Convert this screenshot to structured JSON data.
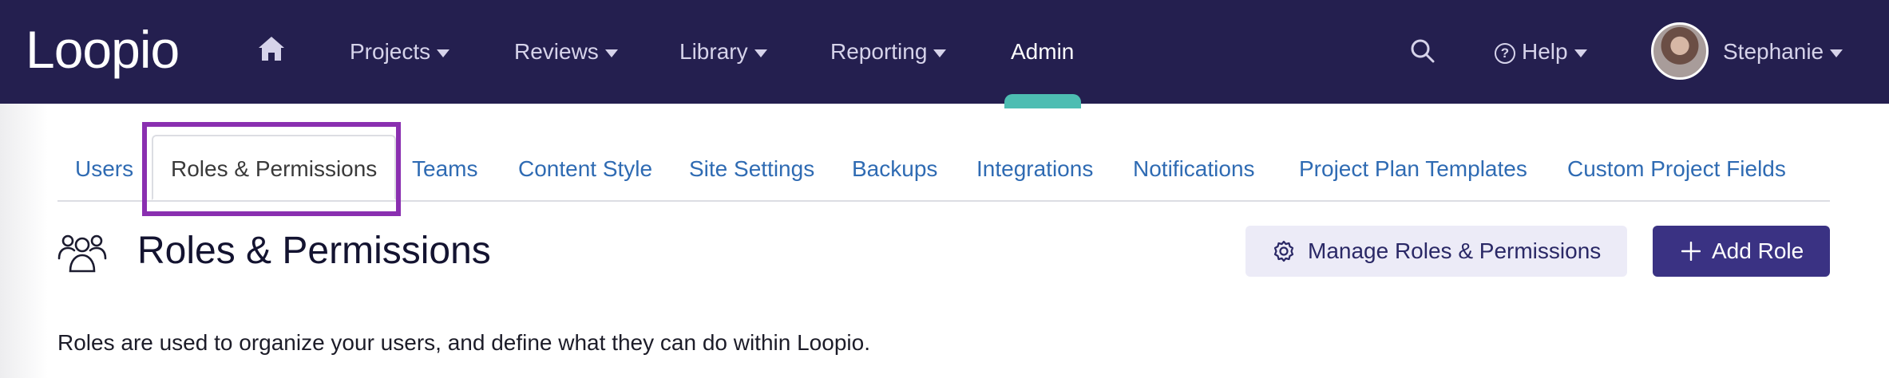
{
  "nav": {
    "logo": "Loopio",
    "items": [
      {
        "label": "Projects"
      },
      {
        "label": "Reviews"
      },
      {
        "label": "Library"
      },
      {
        "label": "Reporting"
      },
      {
        "label": "Admin"
      }
    ],
    "help_label": "Help",
    "user_name": "Stephanie"
  },
  "tabs": [
    {
      "label": "Users"
    },
    {
      "label": "Roles & Permissions",
      "selected": true
    },
    {
      "label": "Teams"
    },
    {
      "label": "Content Style"
    },
    {
      "label": "Site Settings"
    },
    {
      "label": "Backups"
    },
    {
      "label": "Integrations"
    },
    {
      "label": "Notifications"
    },
    {
      "label": "Project Plan Templates"
    },
    {
      "label": "Custom Project Fields"
    }
  ],
  "header": {
    "title": "Roles & Permissions",
    "manage_button": "Manage Roles & Permissions",
    "add_button": "Add Role"
  },
  "description": "Roles are used to organize your users, and define what they can do within Loopio.",
  "colors": {
    "nav_bg": "#241f4f",
    "active_indicator": "#4dbdb2",
    "link": "#2f6bb3",
    "highlight": "#8a2fb0",
    "primary_button": "#3a3283",
    "secondary_button": "#ecebf7"
  },
  "icons": {
    "home": "home-icon",
    "search": "search-icon",
    "help": "help-circle-icon",
    "users": "users-icon",
    "gear": "gear-icon",
    "plus": "plus-icon"
  }
}
